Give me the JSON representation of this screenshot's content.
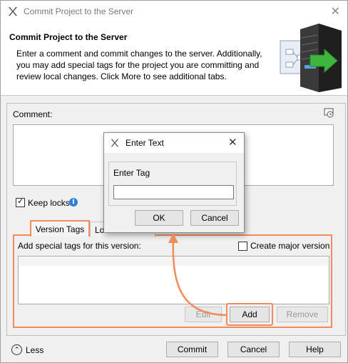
{
  "window": {
    "title": "Commit Project to the Server",
    "close_glyph": "✕"
  },
  "header": {
    "title": "Commit Project to the Server",
    "description": "Enter a comment and commit changes to the server. Additionally, you may add special tags for the project you are committing and review local changes. Click More to see additional tabs.",
    "art_icon": "server-commit-illustration"
  },
  "comment": {
    "label": "Comment:",
    "value": "",
    "history_icon": "comment-history-icon"
  },
  "keep_locks": {
    "label": "Keep locks",
    "checked": true,
    "check_glyph": "✓"
  },
  "tabs": [
    {
      "label": "Version Tags",
      "active": true
    },
    {
      "label": "Lo",
      "active": false
    }
  ],
  "version_tags": {
    "label": "Add special tags for this version:",
    "create_major_label": "Create major version",
    "create_major_checked": false,
    "buttons": {
      "edit": "Edit",
      "add": "Add",
      "remove": "Remove"
    }
  },
  "footer": {
    "less_label": "Less",
    "less_glyph": "⌃",
    "commit": "Commit",
    "cancel": "Cancel",
    "help": "Help"
  },
  "dialog": {
    "title": "Enter Text",
    "close_glyph": "✕",
    "field_label": "Enter Tag",
    "field_value": "",
    "ok": "OK",
    "cancel": "Cancel"
  },
  "colors": {
    "highlight": "#f08c5c",
    "accent_blue": "#2f7fd8"
  }
}
